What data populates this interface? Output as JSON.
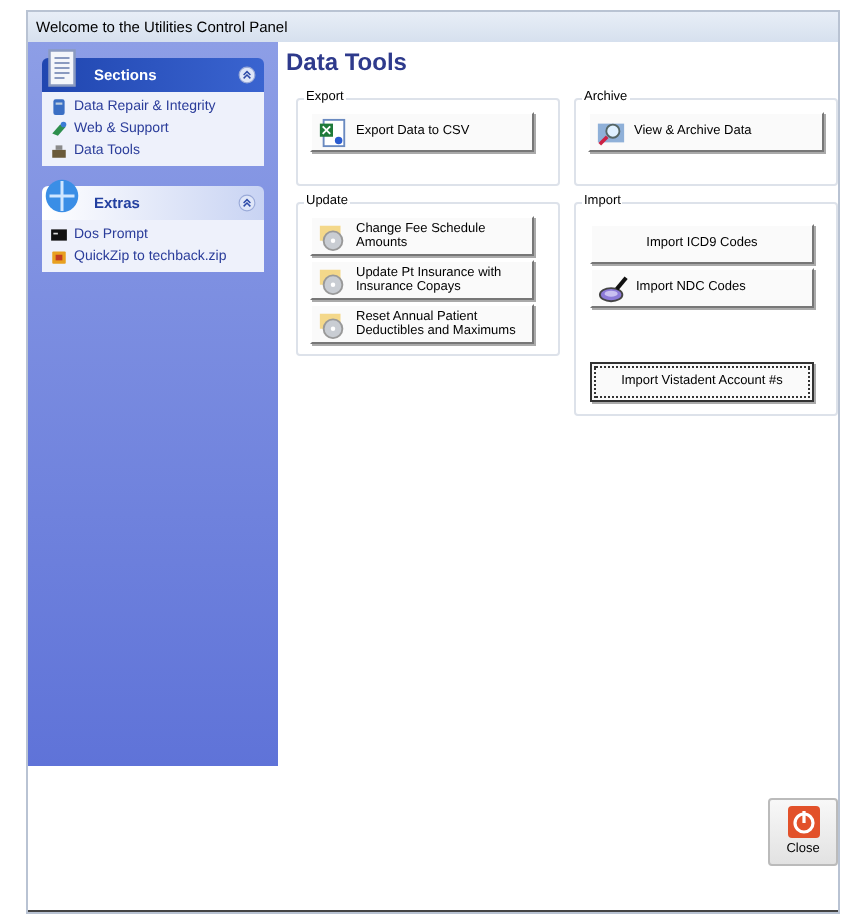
{
  "window": {
    "title": "Welcome to the Utilities Control Panel"
  },
  "sidebar": {
    "panels": [
      {
        "title": "Sections",
        "expanded": true,
        "items": [
          {
            "label": "Data Repair & Integrity"
          },
          {
            "label": "Web & Support"
          },
          {
            "label": "Data Tools"
          }
        ]
      },
      {
        "title": "Extras",
        "expanded": true,
        "items": [
          {
            "label": "Dos Prompt"
          },
          {
            "label": "QuickZip to techback.zip"
          }
        ]
      }
    ]
  },
  "page": {
    "title": "Data Tools"
  },
  "groups": [
    {
      "title": "Export",
      "buttons": [
        {
          "label": "Export Data to CSV",
          "kind": "icon",
          "focused": false
        }
      ]
    },
    {
      "title": "Archive",
      "buttons": [
        {
          "label": "View & Archive Data",
          "kind": "icon",
          "focused": false
        }
      ]
    },
    {
      "title": "Update",
      "buttons": [
        {
          "label": "Change Fee Schedule Amounts",
          "kind": "icon",
          "focused": false
        },
        {
          "label": "Update Pt Insurance with Insurance Copays",
          "kind": "icon",
          "focused": false
        },
        {
          "label": "Reset Annual Patient Deductibles and Maximums",
          "kind": "icon",
          "focused": false
        }
      ]
    },
    {
      "title": "Import",
      "buttons": [
        {
          "label": "Import ICD9 Codes",
          "kind": "plain",
          "focused": false
        },
        {
          "label": "Import NDC Codes",
          "kind": "icon",
          "focused": false
        },
        {
          "label": "Import Vistadent Account #s",
          "kind": "plain",
          "focused": true
        }
      ]
    }
  ],
  "close_button": {
    "label": "Close"
  }
}
